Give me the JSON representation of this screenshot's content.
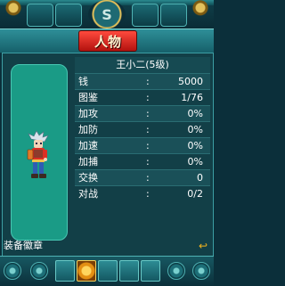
{
  "header": {
    "emblem_glyph": "S",
    "title": "人物"
  },
  "character": {
    "name": "王小二(5级)"
  },
  "stats": [
    {
      "label": "钱",
      "colon": ":",
      "value": "5000"
    },
    {
      "label": "图鉴",
      "colon": ":",
      "value": "1/76"
    },
    {
      "label": "加攻",
      "colon": ":",
      "value": "0%"
    },
    {
      "label": "加防",
      "colon": ":",
      "value": "0%"
    },
    {
      "label": "加速",
      "colon": ":",
      "value": "0%"
    },
    {
      "label": "加捕",
      "colon": ":",
      "value": "0%"
    },
    {
      "label": "交换",
      "colon": ":",
      "value": "0"
    },
    {
      "label": "对战",
      "colon": ":",
      "value": "0/2"
    }
  ],
  "softkeys": {
    "left": "装备徽章",
    "right_glyph": "↩"
  },
  "colors": {
    "portrait_bg": "#1a9b86",
    "title_plate": "#d8241c",
    "frame_teal": "#2e8f98",
    "gold": "#f2b31e"
  }
}
